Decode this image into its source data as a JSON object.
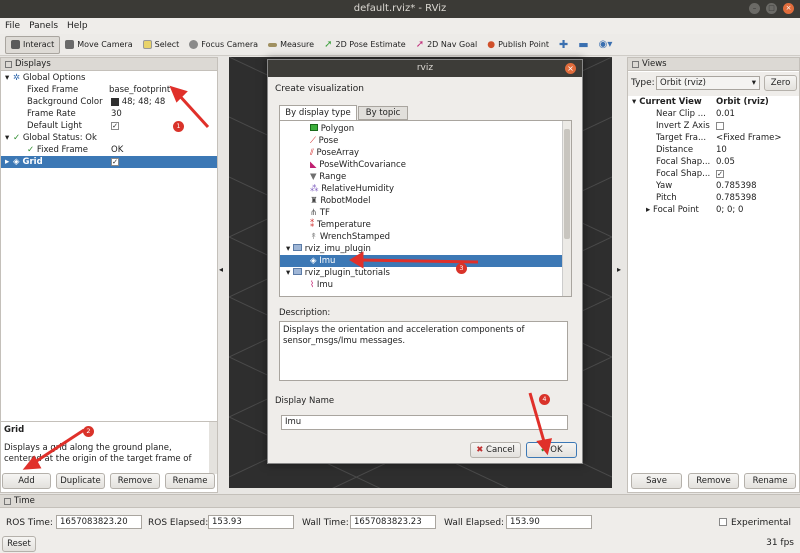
{
  "window": {
    "title": "default.rviz* - RViz"
  },
  "menu": [
    "File",
    "Panels",
    "Help"
  ],
  "toolbar": [
    {
      "label": "Interact",
      "icon": "cursor-icon",
      "color": "#5a5a5a"
    },
    {
      "label": "Move Camera",
      "icon": "move-camera-icon",
      "color": "#6a6a6a"
    },
    {
      "label": "Select",
      "icon": "select-icon",
      "color": "#e8d36a"
    },
    {
      "label": "Focus Camera",
      "icon": "focus-camera-icon",
      "color": "#8a8a8a"
    },
    {
      "label": "Measure",
      "icon": "measure-icon",
      "color": "#a09060"
    },
    {
      "label": "2D Pose Estimate",
      "icon": "pose-estimate-icon",
      "color": "#3ca03c"
    },
    {
      "label": "2D Nav Goal",
      "icon": "nav-goal-icon",
      "color": "#c0307a"
    },
    {
      "label": "Publish Point",
      "icon": "publish-point-icon",
      "color": "#d0502a"
    }
  ],
  "displays": {
    "title": "Displays",
    "rows": [
      {
        "name": "Global Options",
        "value": ""
      },
      {
        "name": "Fixed Frame",
        "value": "base_footprint"
      },
      {
        "name": "Background Color",
        "value": "48; 48; 48"
      },
      {
        "name": "Frame Rate",
        "value": "30"
      },
      {
        "name": "Default Light",
        "value": "✓"
      },
      {
        "name": "Global Status: Ok",
        "value": ""
      },
      {
        "name": "Fixed Frame",
        "value": "OK"
      },
      {
        "name": "Grid",
        "value": "✓"
      }
    ],
    "desc_title": "Grid",
    "desc_text": "Displays a grid along the ground plane, centered at the origin of the target frame of",
    "buttons": [
      "Add",
      "Duplicate",
      "Remove",
      "Rename"
    ]
  },
  "views": {
    "title": "Views",
    "type_label": "Type:",
    "type_value": "Orbit (rviz)",
    "zero": "Zero",
    "rows": [
      {
        "name": "Current View",
        "value": "Orbit (rviz)"
      },
      {
        "name": "Near Clip ...",
        "value": "0.01"
      },
      {
        "name": "Invert Z Axis",
        "value": ""
      },
      {
        "name": "Target Fra...",
        "value": "<Fixed Frame>"
      },
      {
        "name": "Distance",
        "value": "10"
      },
      {
        "name": "Focal Shap...",
        "value": "0.05"
      },
      {
        "name": "Focal Shap...",
        "value": "✓"
      },
      {
        "name": "Yaw",
        "value": "0.785398"
      },
      {
        "name": "Pitch",
        "value": "0.785398"
      },
      {
        "name": "Focal Point",
        "value": "0; 0; 0"
      }
    ],
    "buttons": [
      "Save",
      "Remove",
      "Rename"
    ]
  },
  "dialog": {
    "title": "rviz",
    "heading": "Create visualization",
    "tabs": [
      "By display type",
      "By topic"
    ],
    "items": [
      {
        "label": "Polygon",
        "color": "#3cb03c"
      },
      {
        "label": "Pose",
        "color": "#d02020"
      },
      {
        "label": "PoseArray",
        "color": "#d02020"
      },
      {
        "label": "PoseWithCovariance",
        "color": "#c02070"
      },
      {
        "label": "Range",
        "color": "#707070"
      },
      {
        "label": "RelativeHumidity",
        "color": "#8060c0"
      },
      {
        "label": "RobotModel",
        "color": "#404040"
      },
      {
        "label": "TF",
        "color": "#606060"
      },
      {
        "label": "Temperature",
        "color": "#d03030"
      },
      {
        "label": "WrenchStamped",
        "color": "#b0b0b0"
      }
    ],
    "group1": "rviz_imu_plugin",
    "group1_item": "Imu",
    "group2": "rviz_plugin_tutorials",
    "group2_item": "Imu",
    "desc_label": "Description:",
    "desc_text": "Displays the orientation and acceleration components of sensor_msgs/Imu messages.",
    "name_label": "Display Name",
    "name_value": "Imu",
    "cancel": "Cancel",
    "ok": "OK"
  },
  "time": {
    "title": "Time",
    "ros_time_label": "ROS Time:",
    "ros_time": "1657083823.20",
    "ros_elapsed_label": "ROS Elapsed:",
    "ros_elapsed": "153.93",
    "wall_time_label": "Wall Time:",
    "wall_time": "1657083823.23",
    "wall_elapsed_label": "Wall Elapsed:",
    "wall_elapsed": "153.90",
    "experimental": "Experimental",
    "reset": "Reset",
    "fps": "31 fps"
  },
  "annotations": [
    "1",
    "2",
    "3",
    "4"
  ]
}
